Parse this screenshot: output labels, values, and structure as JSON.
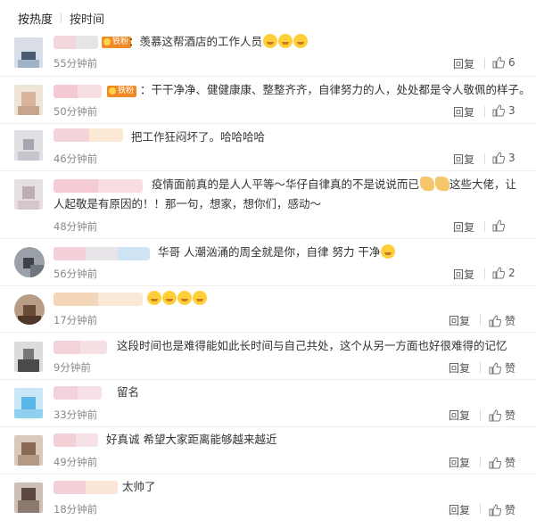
{
  "tabs": [
    {
      "label": "按热度",
      "active": true
    },
    {
      "label": "按时间",
      "active": false
    }
  ],
  "reply_label": "回复",
  "like_label": "赞",
  "badge_label": "铁粉",
  "colors": {
    "time": "#888888",
    "badge": "#f08a24",
    "emoji": "#ffcf3a"
  },
  "comments": [
    {
      "text": "：羡慕这帮酒店的工作人员",
      "emojis": 3,
      "time": "55分钟前",
      "likes": "6",
      "badge": true
    },
    {
      "text": "：干干净净、健健康康、整整齐齐，自律努力的人，处处都是令人敬佩的样子。",
      "emojis": 0,
      "time": "50分钟前",
      "likes": "3",
      "badge": true
    },
    {
      "text": "把工作狂闷坏了。哈哈哈哈",
      "emojis": 0,
      "time": "46分钟前",
      "likes": "3",
      "badge": false
    },
    {
      "text": "疫情面前真的是人人平等～华仔自律真的不是说说而已",
      "text2": "这些大佬，让人起敬是有原因的！！那一句，想家，想你们，感动～",
      "emojis": 2,
      "emoji_type": "hand",
      "time": "48分钟前",
      "likes": "",
      "badge": false
    },
    {
      "text": "华哥 人潮汹涌的周全就是你，自律 努力 干净",
      "emojis": 1,
      "time": "56分钟前",
      "likes": "2",
      "badge": false
    },
    {
      "text": "",
      "emojis": 4,
      "time": "17分钟前",
      "likes": "赞",
      "badge": false
    },
    {
      "text": "这段时间也是难得能如此长时间与自己共处，这个从另一方面也好很难得的记忆",
      "emojis": 0,
      "time": "9分钟前",
      "likes": "赞",
      "badge": false
    },
    {
      "text": "留名",
      "emojis": 0,
      "time": "33分钟前",
      "likes": "赞",
      "badge": false
    },
    {
      "text": "好真诚 希望大家距离能够越来越近",
      "emojis": 0,
      "time": "49分钟前",
      "likes": "赞",
      "badge": false
    },
    {
      "text": "太帅了",
      "emojis": 0,
      "time": "18分钟前",
      "likes": "赞",
      "badge": false
    }
  ]
}
